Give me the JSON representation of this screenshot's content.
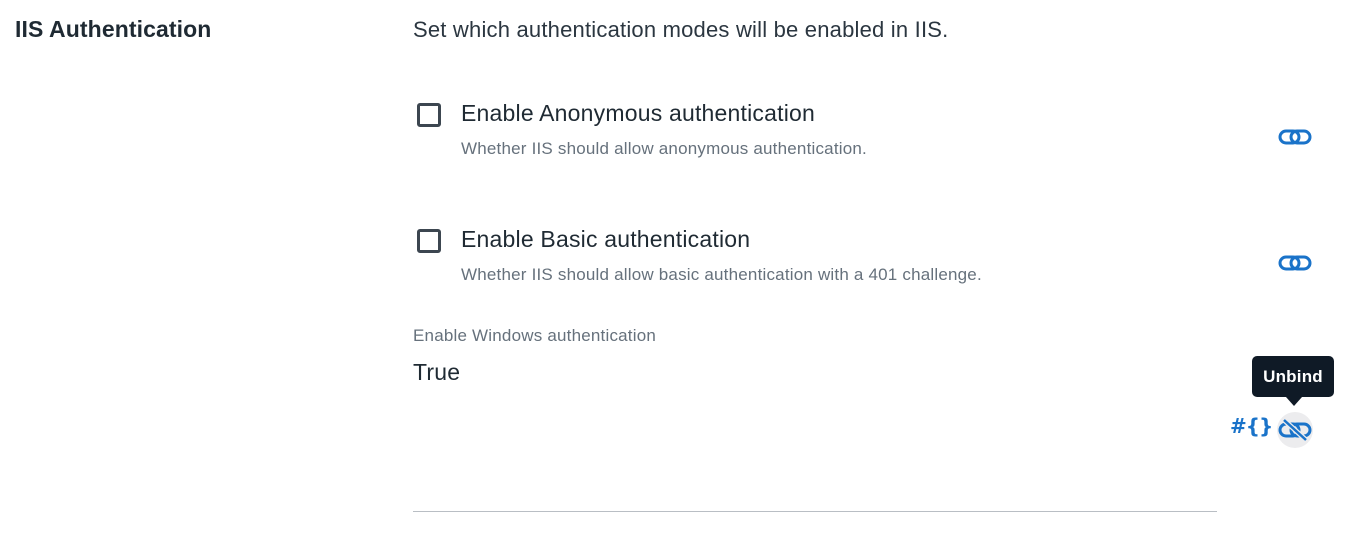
{
  "section": {
    "title": "IIS Authentication",
    "description": "Set which authentication modes will be enabled in IIS."
  },
  "options": [
    {
      "label": "Enable Anonymous authentication",
      "note": "Whether IIS should allow anonymous authentication.",
      "checked": false,
      "bind_icon": "link-icon"
    },
    {
      "label": "Enable Basic authentication",
      "note": "Whether IIS should allow basic authentication with a 401 challenge.",
      "checked": false,
      "bind_icon": "link-icon"
    }
  ],
  "windows_auth": {
    "label": "Enable Windows authentication",
    "value": "True",
    "expression_icon": "#{}",
    "unbind_icon": "unlink-icon"
  },
  "tooltip": {
    "text": "Unbind"
  },
  "colors": {
    "accent": "#1a73c9",
    "text": "#1f2a33",
    "muted": "#66717c",
    "tooltip_bg": "#0f1a26"
  }
}
